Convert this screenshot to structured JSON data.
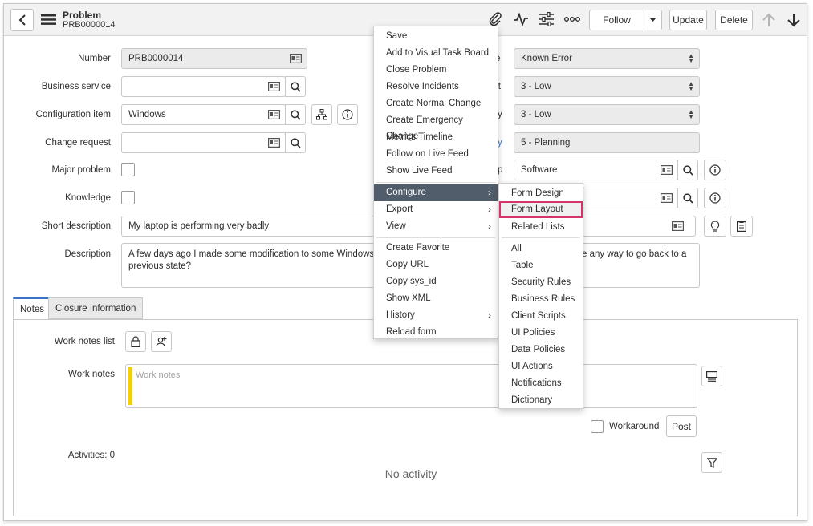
{
  "header": {
    "title": "Problem",
    "record_number": "PRB0000014",
    "follow_label": "Follow",
    "update_label": "Update",
    "delete_label": "Delete"
  },
  "left_form": {
    "number_label": "Number",
    "number_value": "PRB0000014",
    "business_service_label": "Business service",
    "business_service_value": "",
    "configuration_item_label": "Configuration item",
    "configuration_item_value": "Windows",
    "change_request_label": "Change request",
    "change_request_value": "",
    "major_problem_label": "Major problem",
    "knowledge_label": "Knowledge",
    "short_description_label": "Short description",
    "short_description_value": "My laptop is performing very badly",
    "description_label": "Description",
    "description_line1_left": "A few days ago I made some modification to some Windows confi",
    "description_line1_right": "e any way to go back to a",
    "description_line2": "previous state?"
  },
  "right_form": {
    "label_state_fragment": "e",
    "state_value": "Known Error",
    "label_impact_fragment": "ct",
    "impact_value": "3 - Low",
    "label_urgency_fragment": "y",
    "urgency_value": "3 - Low",
    "label_priority_fragment": "y",
    "priority_value": "5 - Planning",
    "label_category_fragment": "p",
    "category_value": "Software",
    "assigned_value": ""
  },
  "tabs": {
    "notes": "Notes",
    "closure": "Closure Information"
  },
  "notes": {
    "work_notes_list_label": "Work notes list",
    "work_notes_label": "Work notes",
    "work_notes_placeholder": "Work notes",
    "workaround_label": "Workaround",
    "post_label": "Post",
    "activities_label": "Activities: 0",
    "no_activity": "No activity"
  },
  "context_menu": {
    "items": [
      {
        "label": "Save"
      },
      {
        "label": "Add to Visual Task Board"
      },
      {
        "label": "Close Problem"
      },
      {
        "label": "Resolve Incidents"
      },
      {
        "label": "Create Normal Change"
      },
      {
        "label": "Create Emergency Change"
      },
      {
        "label": "Metrics Timeline"
      },
      {
        "label": "Follow on Live Feed"
      },
      {
        "label": "Show Live Feed"
      },
      {
        "label": "Configure"
      },
      {
        "label": "Export"
      },
      {
        "label": "View"
      },
      {
        "label": "Create Favorite"
      },
      {
        "label": "Copy URL"
      },
      {
        "label": "Copy sys_id"
      },
      {
        "label": "Show XML"
      },
      {
        "label": "History"
      },
      {
        "label": "Reload form"
      }
    ],
    "active_item": "Configure"
  },
  "submenu": {
    "items": [
      {
        "label": "Form Design"
      },
      {
        "label": "Form Layout"
      },
      {
        "label": "Related Lists"
      },
      {
        "label": "All"
      },
      {
        "label": "Table"
      },
      {
        "label": "Security Rules"
      },
      {
        "label": "Business Rules"
      },
      {
        "label": "Client Scripts"
      },
      {
        "label": "UI Policies"
      },
      {
        "label": "Data Policies"
      },
      {
        "label": "UI Actions"
      },
      {
        "label": "Notifications"
      },
      {
        "label": "Dictionary"
      }
    ],
    "highlighted_item": "Form Layout"
  },
  "colors": {
    "header_bg": "#f2f2f2",
    "menu_active_bg": "#515d6b",
    "highlight_border": "#d6336c",
    "work_notes_bar": "#f5d000",
    "link_blue": "#3b73c9"
  },
  "icons": {
    "back": "chevron-left-icon",
    "menu": "hamburger-icon",
    "attachment": "paperclip-icon",
    "activity": "pulse-icon",
    "settings": "sliders-icon",
    "more": "ellipsis-icon",
    "up": "arrow-up-icon",
    "down": "arrow-down-icon"
  }
}
